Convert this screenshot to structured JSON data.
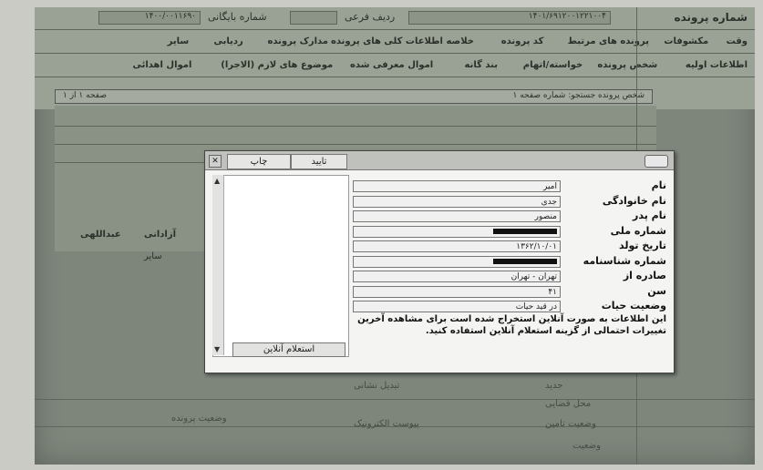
{
  "background": {
    "file_number_label": "شماره پرونده",
    "file_number_value": "۱۴۰۱/۶۹۱۲۰۰۱۲۲۱۰۰۴",
    "row_label": "ردیف فرعی",
    "archive_label": "شماره بایگانی",
    "archive_value": "۱۴۰۰/۰۰۱۱۶۹۰",
    "tabs_row1": [
      "وقت",
      "مکشوفات",
      "پرونده های مرتبط",
      "کد پرونده",
      "خلاصه اطلاعات کلی های پرونده",
      "مدارک پرونده",
      "ردیابی",
      "سایر"
    ],
    "tabs_row2": [
      "اطلاعات اولیه",
      "شخص پرونده",
      "خواسته/اتهام",
      "بند گانه",
      "اموال معرفی شده",
      "موضوع های لازم (الاجرا)",
      "اموال اهدائی"
    ],
    "nav_text": "شخص پرونده جستجو: شماره صفحه ۱",
    "nav_page": "صفحه ۱ از ۱",
    "side_values": [
      "آزادانی",
      "عبداللهی",
      "سایر"
    ],
    "bottom_labels": [
      "تبدیل نشانی",
      "جدید",
      "وضعیت پرونده",
      "محل قضایی",
      "پیوست الکترونیک",
      "وضعیت تامین",
      "وضعیت"
    ]
  },
  "dialog": {
    "tabs": [
      "تایید",
      "چاپ"
    ],
    "close_glyph": "✕",
    "inquiry_button": "استعلام آنلاین",
    "fields": [
      {
        "label": "نام",
        "value": "امیر",
        "redacted": false
      },
      {
        "label": "نام خانوادگی",
        "value": "جدی",
        "redacted": false
      },
      {
        "label": "نام پدر",
        "value": "منصور",
        "redacted": false
      },
      {
        "label": "شماره ملی",
        "value": "",
        "redacted": true
      },
      {
        "label": "تاریخ تولد",
        "value": "۱۳۶۲/۱۰/۰۱",
        "redacted": false
      },
      {
        "label": "شماره شناسنامه",
        "value": "",
        "redacted": true
      },
      {
        "label": "صادره از",
        "value": "تهران - تهران",
        "redacted": false
      },
      {
        "label": "سن",
        "value": "۴۱",
        "redacted": false
      },
      {
        "label": "وضعیت حیات",
        "value": "در قید حیات",
        "redacted": false
      }
    ],
    "note": "این اطلاعات به صورت آنلاین استخراج شده است برای مشاهده آخرین تغییرات احتمالی از گزینه استعلام آنلاین استفاده کنید."
  },
  "colors": {
    "screen_bg": "#7e867c",
    "dialog_bg": "#f4f4f2",
    "redaction": "#111111"
  }
}
